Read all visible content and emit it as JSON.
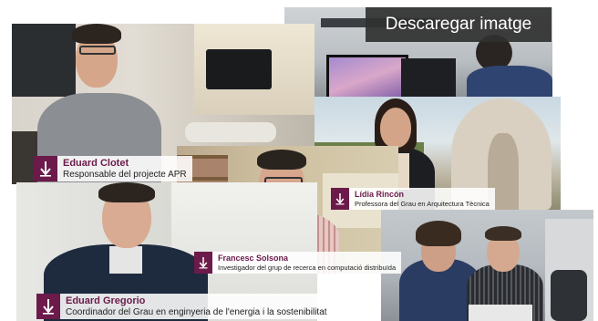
{
  "download": {
    "label": "Descaregar imatge"
  },
  "people": [
    {
      "name": "Eduard Clotet",
      "role": "Responsable del projecte APR"
    },
    {
      "name": "Lídia Rincón",
      "role": "Professora del Grau en Arquitectura Tècnica"
    },
    {
      "name": "Francesc Solsona",
      "role": "Investigador del grup de recerca en computació distribuïda"
    },
    {
      "name": "Eduard Gregorio",
      "role": "Coordinador del Grau en enginyeria de l'energia i la sostenibilitat"
    }
  ],
  "colors": {
    "brand": "#6b1a4a",
    "button_bg": "#303030"
  },
  "icons": {
    "logo": "university-logo-icon"
  }
}
